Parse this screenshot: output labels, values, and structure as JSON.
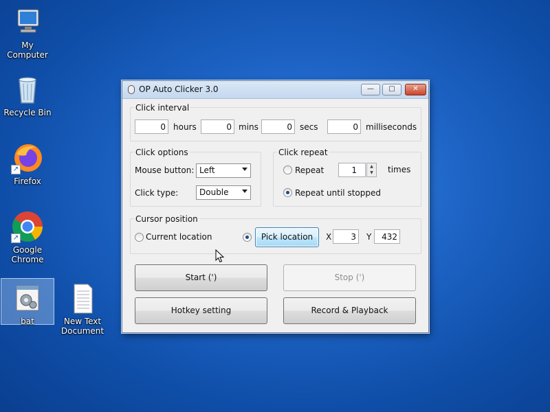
{
  "desktop": {
    "icons": [
      {
        "label": "My Computer",
        "icon": "computer-icon"
      },
      {
        "label": "Recycle Bin",
        "icon": "recycle-bin-icon"
      },
      {
        "label": "Firefox",
        "icon": "firefox-icon"
      },
      {
        "label": "Google Chrome",
        "icon": "chrome-icon"
      },
      {
        "label": "bat",
        "icon": "batch-file-icon"
      },
      {
        "label": "New Text Document",
        "icon": "text-document-icon"
      }
    ]
  },
  "window": {
    "title": "OP Auto Clicker 3.0",
    "minimize_glyph": "—",
    "maximize_glyph": "□",
    "close_glyph": "✕",
    "click_interval": {
      "label": "Click interval",
      "hours_value": "0",
      "hours_label": "hours",
      "mins_value": "0",
      "mins_label": "mins",
      "secs_value": "0",
      "secs_label": "secs",
      "ms_value": "0",
      "ms_label": "milliseconds"
    },
    "click_options": {
      "label": "Click options",
      "mouse_button_label": "Mouse button:",
      "mouse_button_value": "Left",
      "click_type_label": "Click type:",
      "click_type_value": "Double"
    },
    "click_repeat": {
      "label": "Click repeat",
      "repeat_label": "Repeat",
      "repeat_value": "1",
      "times_label": "times",
      "until_stopped_label": "Repeat until stopped",
      "selected": "until_stopped"
    },
    "cursor_position": {
      "label": "Cursor position",
      "current_location_label": "Current location",
      "pick_location_label": "Pick location",
      "x_label": "X",
      "x_value": "3",
      "y_label": "Y",
      "y_value": "432",
      "selected": "pick_location"
    },
    "buttons": {
      "start": "Start (')",
      "stop": "Stop (')",
      "hotkey": "Hotkey setting",
      "record": "Record & Playback"
    }
  }
}
